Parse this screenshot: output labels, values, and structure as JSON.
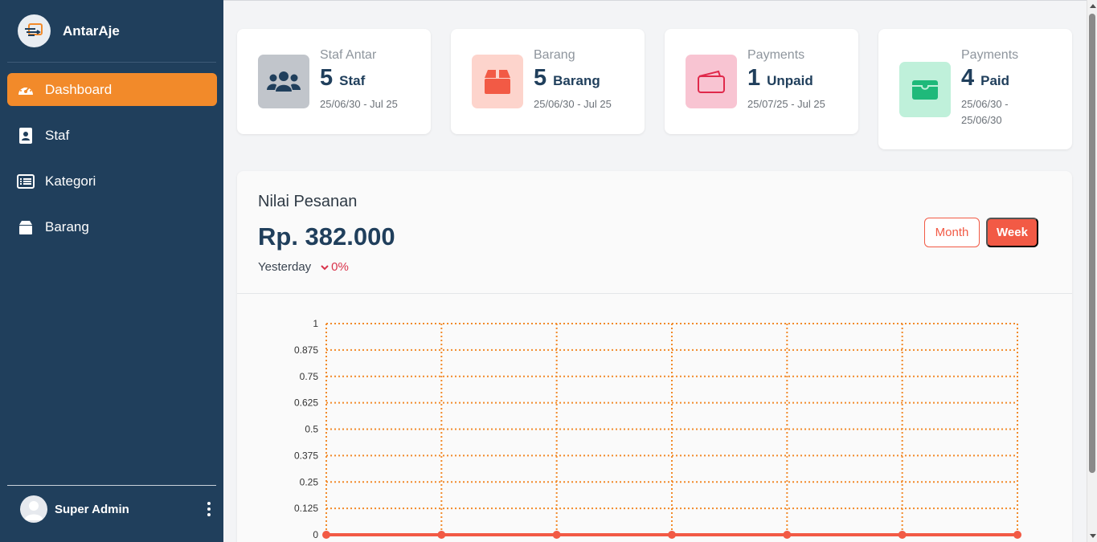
{
  "app": {
    "name": "AntarAje"
  },
  "sidebar": {
    "items": [
      {
        "label": "Dashboard",
        "icon": "gauge-icon",
        "active": true
      },
      {
        "label": "Staf",
        "icon": "id-badge-icon",
        "active": false
      },
      {
        "label": "Kategori",
        "icon": "list-icon",
        "active": false
      },
      {
        "label": "Barang",
        "icon": "box-icon",
        "active": false
      }
    ],
    "user": {
      "name": "Super Admin"
    }
  },
  "cards": [
    {
      "label": "Staf Antar",
      "value": "5",
      "unit": "Staf",
      "date": "25/06/30 - Jul 25",
      "icon": "users-icon",
      "tile_color": "#c1c5cb",
      "icon_color": "#203f5c"
    },
    {
      "label": "Barang",
      "value": "5",
      "unit": "Barang",
      "date": "25/06/30 - Jul 25",
      "icon": "box-icon",
      "tile_color": "#fdd4cc",
      "icon_color": "#f25a45"
    },
    {
      "label": "Payments",
      "value": "1",
      "unit": "Unpaid",
      "date": "25/07/25 - Jul 25",
      "icon": "wallet-icon",
      "tile_color": "#f8c4d2",
      "icon_color": "#e0294b"
    },
    {
      "label": "Payments",
      "value": "4",
      "unit": "Paid",
      "date": "25/06/30 - 25/06/30",
      "icon": "wallet-open-icon",
      "tile_color": "#bff0da",
      "icon_color": "#1fb97a"
    }
  ],
  "panel": {
    "title": "Nilai Pesanan",
    "amount": "Rp. 382.000",
    "compare_label": "Yesterday",
    "change": "0%",
    "buttons": {
      "month": "Month",
      "week": "Week"
    }
  },
  "chart_data": {
    "type": "line",
    "y_ticks": [
      "1",
      "0.875",
      "0.75",
      "0.625",
      "0.5",
      "0.375",
      "0.25",
      "0.125",
      "0"
    ],
    "ylim": [
      0,
      1
    ],
    "grid": true,
    "series": [
      {
        "values": [
          0,
          0,
          0,
          0,
          0,
          0,
          0
        ]
      }
    ],
    "colors": {
      "grid": "#f28a2a",
      "line": "#f25a45"
    }
  }
}
